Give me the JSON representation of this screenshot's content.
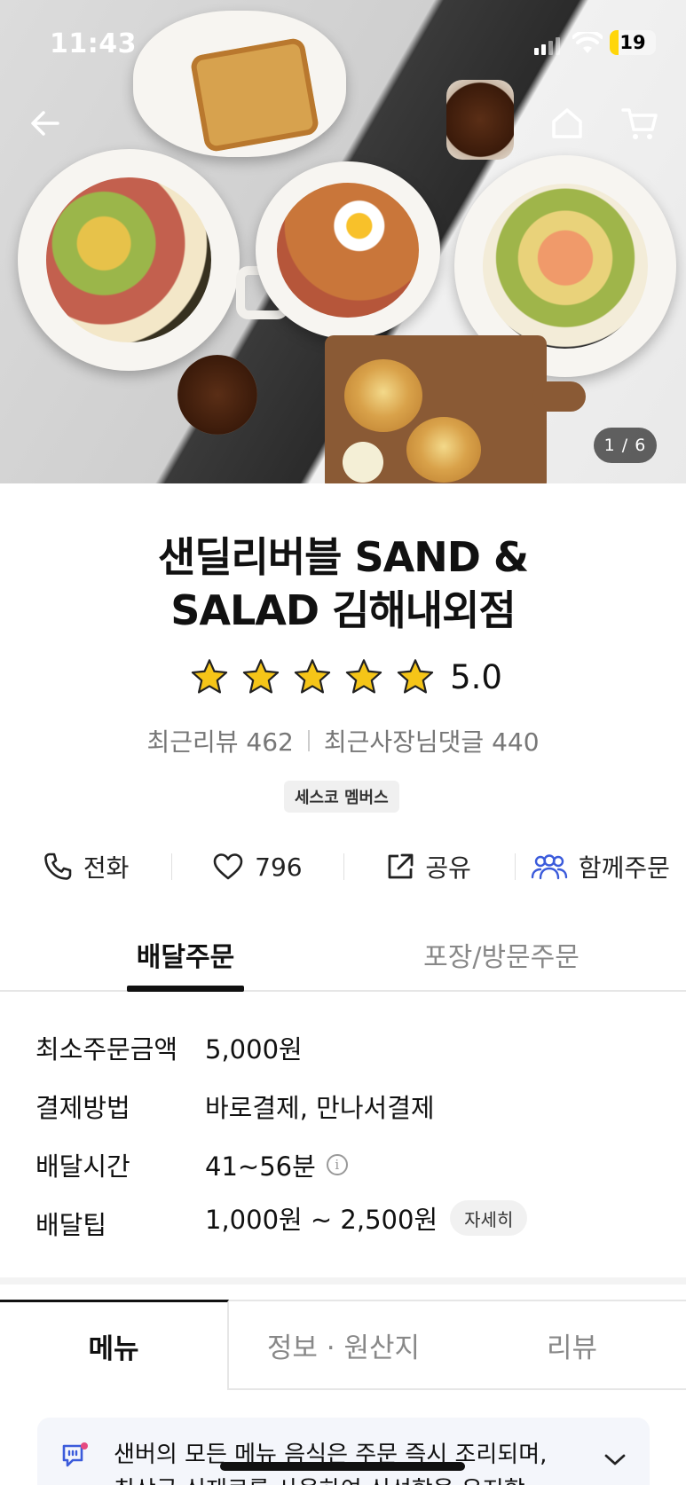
{
  "status_bar": {
    "time": "11:43",
    "battery": "19"
  },
  "hero": {
    "pager": "1 / 6"
  },
  "store": {
    "name_line1": "샌딜리버블 SAND &",
    "name_line2": "SALAD 김해내외점",
    "rating": "5.0",
    "stars": 5,
    "recent_reviews": "최근리뷰 462",
    "owner_replies": "최근사장님댓글 440",
    "badge": "세스코 멤버스"
  },
  "actions": {
    "call": "전화",
    "likes": "796",
    "share": "공유",
    "group_order": "함께주문"
  },
  "order_tabs": {
    "delivery": "배달주문",
    "pickup": "포장/방문주문"
  },
  "info": [
    {
      "label": "최소주문금액",
      "value": "5,000원"
    },
    {
      "label": "결제방법",
      "value": "바로결제, 만나서결제"
    },
    {
      "label": "배달시간",
      "value": "41~56분"
    },
    {
      "label": "배달팁",
      "value": "1,000원 ~ 2,500원",
      "button": "자세히"
    }
  ],
  "menu_tabs": {
    "menu": "메뉴",
    "info": "정보 · 원산지",
    "review": "리뷰"
  },
  "notice": {
    "line1": "샌버의 모든 메뉴 음식은 주문 즉시 조리되며,",
    "line2": "최상급 식재료를 사용하여 신선함을 유지합"
  },
  "colors": {
    "accent_blue": "#3b5bdb",
    "battery_yellow": "#ffd60a",
    "star_yellow": "#f5c518"
  }
}
